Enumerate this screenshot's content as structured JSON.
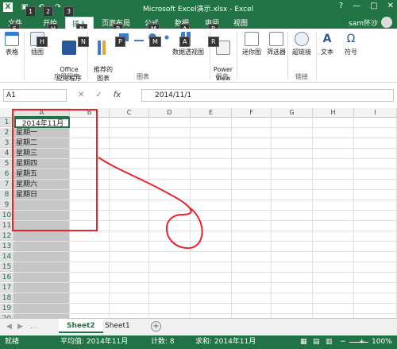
{
  "window": {
    "title": "Microsoft Excel演示.xlsx - Excel",
    "help": "?",
    "minimize": "—",
    "restore": "□",
    "close": "✕"
  },
  "keytips": {
    "qat": [
      "1",
      "2",
      "3"
    ],
    "file": "F",
    "home": "H",
    "insert": "N",
    "page_layout": "P",
    "formulas": "M",
    "data": "A",
    "review": "R"
  },
  "tabs": [
    "文件",
    "开始",
    "插入",
    "页面布局",
    "公式",
    "数据",
    "审阅",
    "视图"
  ],
  "user": "sam怀沙",
  "ribbon": {
    "buttons": [
      "表格",
      "插图",
      "Office\n应用程序",
      "推荐的\n图表",
      "数据透视图",
      "Power\nView",
      "迷你图",
      "筛选器",
      "超链接",
      "文本",
      "符号"
    ],
    "groups": [
      "应用程序",
      "图表",
      "报告",
      "链接"
    ]
  },
  "formula_bar": {
    "name_box": "A1",
    "cancel": "✕",
    "enter": "✓",
    "fx": "fx",
    "value": "2014/11/1"
  },
  "columns": [
    "A",
    "B",
    "C",
    "D",
    "E",
    "F",
    "G",
    "H",
    "I"
  ],
  "rows": [
    "1",
    "2",
    "3",
    "4",
    "5",
    "6",
    "7",
    "8",
    "9",
    "10",
    "11",
    "12",
    "13",
    "14",
    "15",
    "16",
    "17",
    "18",
    "19",
    "20"
  ],
  "cells": {
    "A1": "2014年11月",
    "A2": "星期一",
    "A3": "星期二",
    "A4": "星期三",
    "A5": "星期四",
    "A6": "星期五",
    "A7": "星期六",
    "A8": "星期日"
  },
  "sheets": [
    "Sheet2",
    "Sheet1"
  ],
  "status": {
    "ready": "就绪",
    "average": "平均值: 2014年11月",
    "count": "计数: 8",
    "sum": "求和: 2014年11月",
    "zoom": "100%"
  },
  "colors": {
    "excel_green": "#217346",
    "annotation_red": "#e8232a"
  }
}
